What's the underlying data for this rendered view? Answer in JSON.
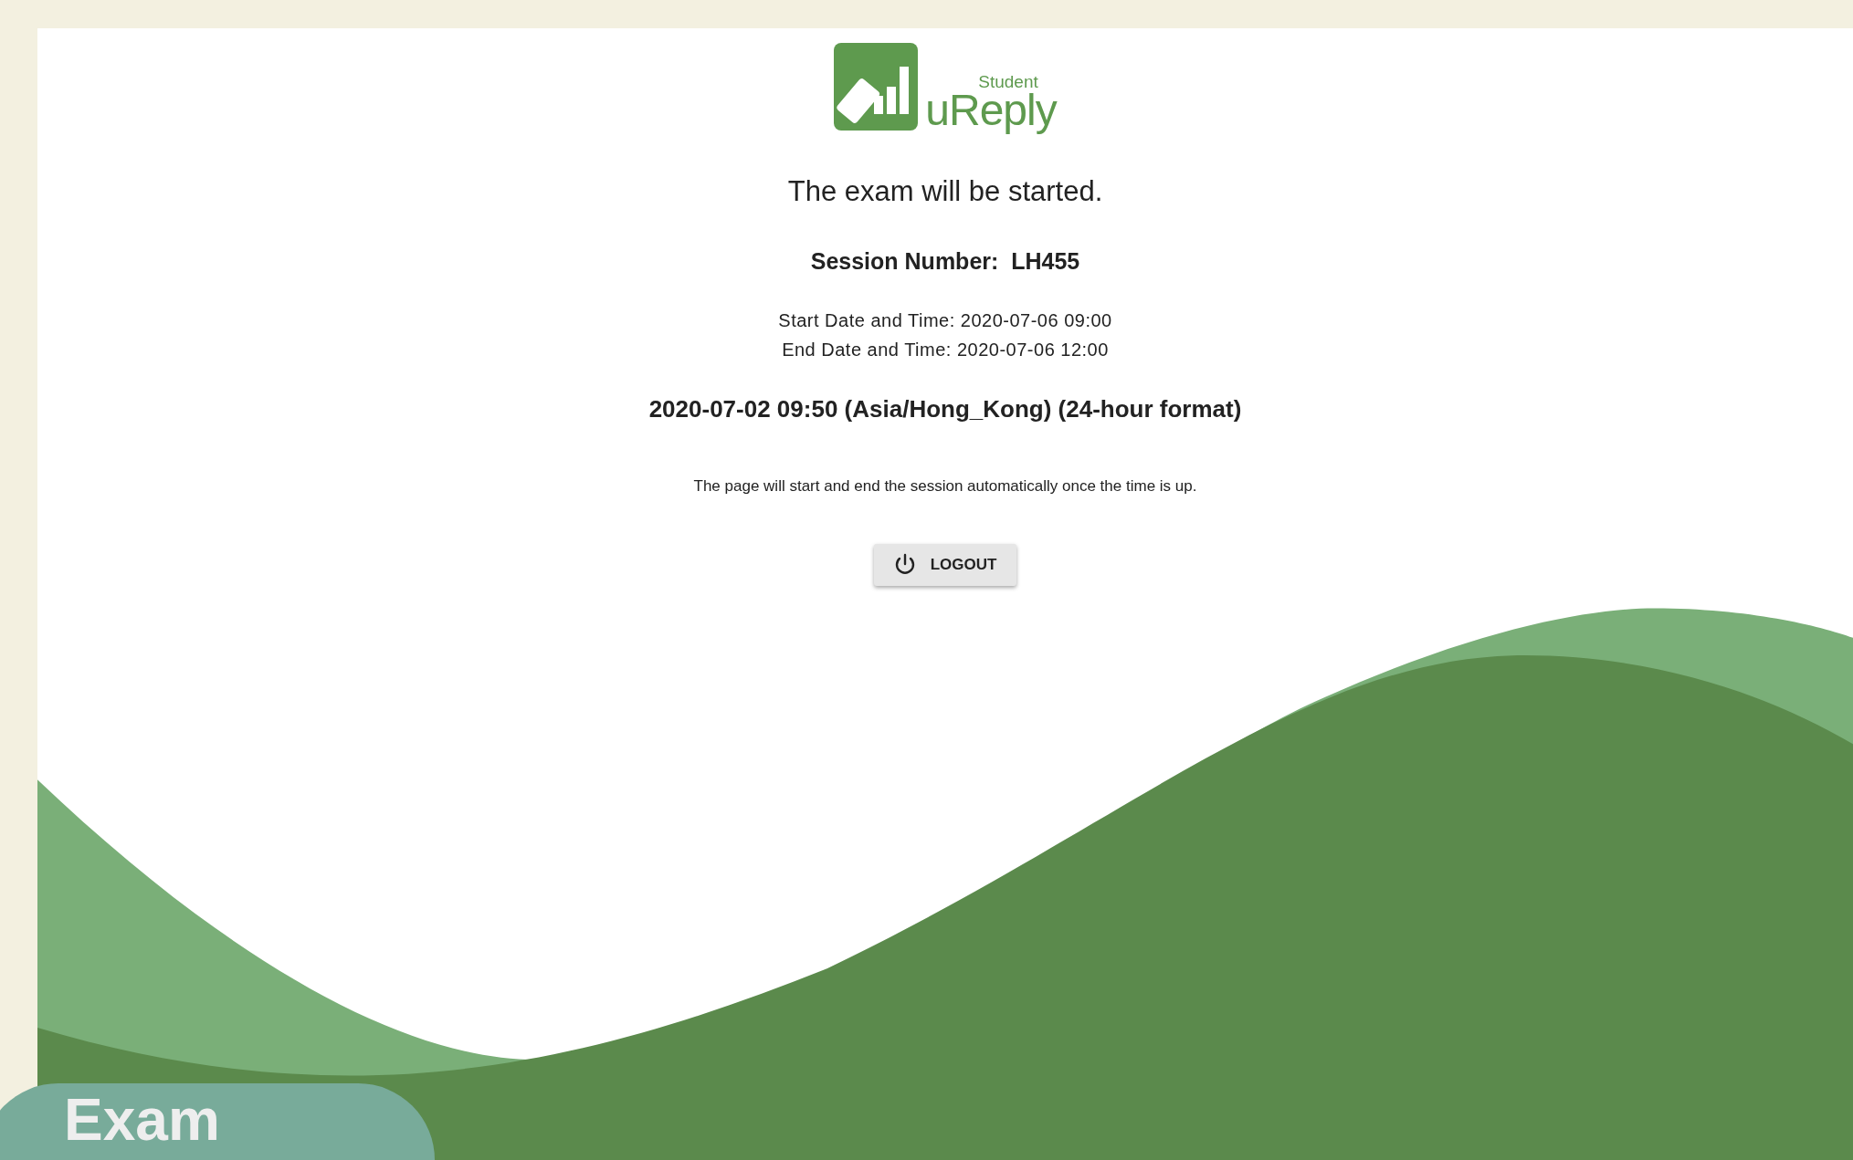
{
  "logo": {
    "superscript": "Student",
    "name": "uReply"
  },
  "heading": "The exam will be started.",
  "session": {
    "label": "Session Number:",
    "value": "LH455"
  },
  "schedule": [
    "Start Date and Time: 2020-07-06 09:00",
    "End Date and Time: 2020-07-06 12:00"
  ],
  "current_time": "2020-07-02 09:50 (Asia/Hong_Kong) (24-hour format)",
  "note": "The page will start and end the session automatically once the time is up.",
  "logout_button": "LOGOUT",
  "corner_badge": "Exam"
}
